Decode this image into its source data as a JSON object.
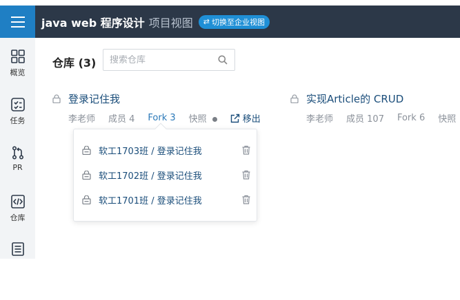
{
  "header": {
    "course_title": "java web 程序设计",
    "view_name": "项目视图",
    "switch_label": "切换至企业视图"
  },
  "sidebar": {
    "items": [
      {
        "label": "概览",
        "icon": "overview-icon"
      },
      {
        "label": "任务",
        "icon": "task-icon"
      },
      {
        "label": "PR",
        "icon": "pull-request-icon"
      },
      {
        "label": "仓库",
        "icon": "code-icon"
      },
      {
        "label": "",
        "icon": "document-icon"
      }
    ]
  },
  "main": {
    "title": "仓库 (3)",
    "search_placeholder": "搜索仓库",
    "repos": [
      {
        "name": "登录记住我",
        "owner": "李老师",
        "members": "成员 4",
        "forks": "Fork 3",
        "snapshot": "快照",
        "action": "移出"
      },
      {
        "name": "实现Article的 CRUD",
        "owner": "李老师",
        "members": "成员 107",
        "forks": "Fork 6",
        "snapshot": "快照"
      }
    ],
    "fork_popover": {
      "items": [
        {
          "name": "软工1703班 / 登录记住我"
        },
        {
          "name": "软工1702班 / 登录记住我"
        },
        {
          "name": "软工1701班 / 登录记住我"
        }
      ]
    }
  }
}
